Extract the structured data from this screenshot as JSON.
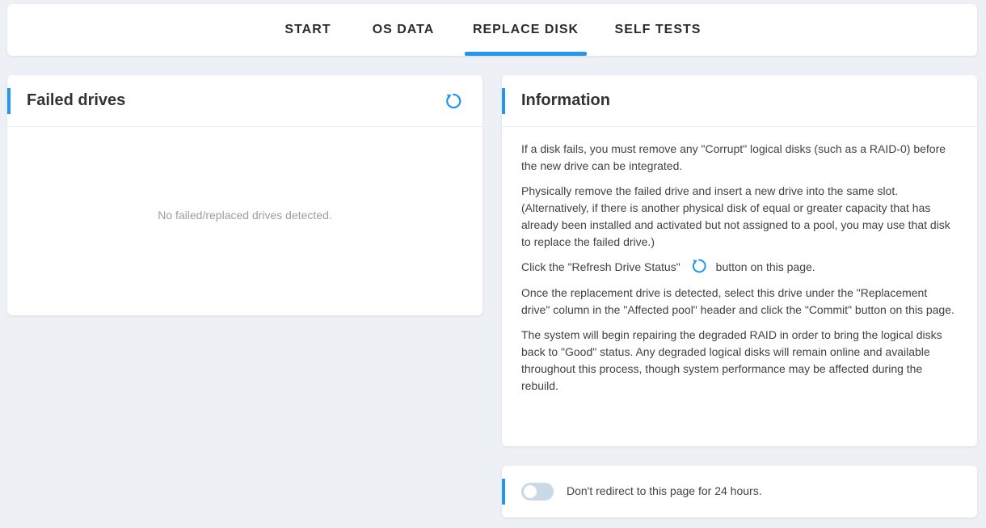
{
  "tabs": [
    {
      "label": "START"
    },
    {
      "label": "OS DATA"
    },
    {
      "label": "REPLACE DISK"
    },
    {
      "label": "SELF TESTS"
    }
  ],
  "active_tab": "REPLACE DISK",
  "accent_color": "#2196f3",
  "failed_drives": {
    "title": "Failed drives",
    "refresh_icon": "refresh-icon",
    "empty_message": "No failed/replaced drives detected."
  },
  "information": {
    "title": "Information",
    "paragraphs": [
      "If a disk fails, you must remove any \"Corrupt\" logical disks (such as a RAID-0) before the new drive can be integrated.",
      "Physically remove the failed drive and insert a new drive into the same slot. (Alternatively, if there is another physical disk of equal or greater capacity that has already been installed and activated but not assigned to a pool, you may use that disk to replace the failed drive.)",
      "Once the replacement drive is detected, select this drive under the \"Replacement drive\" column in the \"Affected pool\" header and click the \"Commit\" button on this page.",
      "The system will begin repairing the degraded RAID in order to bring the logical disks back to \"Good\" status. Any degraded logical disks will remain online and available throughout this process, though system performance may be affected during the rebuild."
    ],
    "refresh_line_before": "Click the \"Refresh Drive Status\"",
    "refresh_line_after": "button on this page."
  },
  "redirect_toggle": {
    "label": "Don't redirect to this page for 24 hours.",
    "enabled": false
  }
}
